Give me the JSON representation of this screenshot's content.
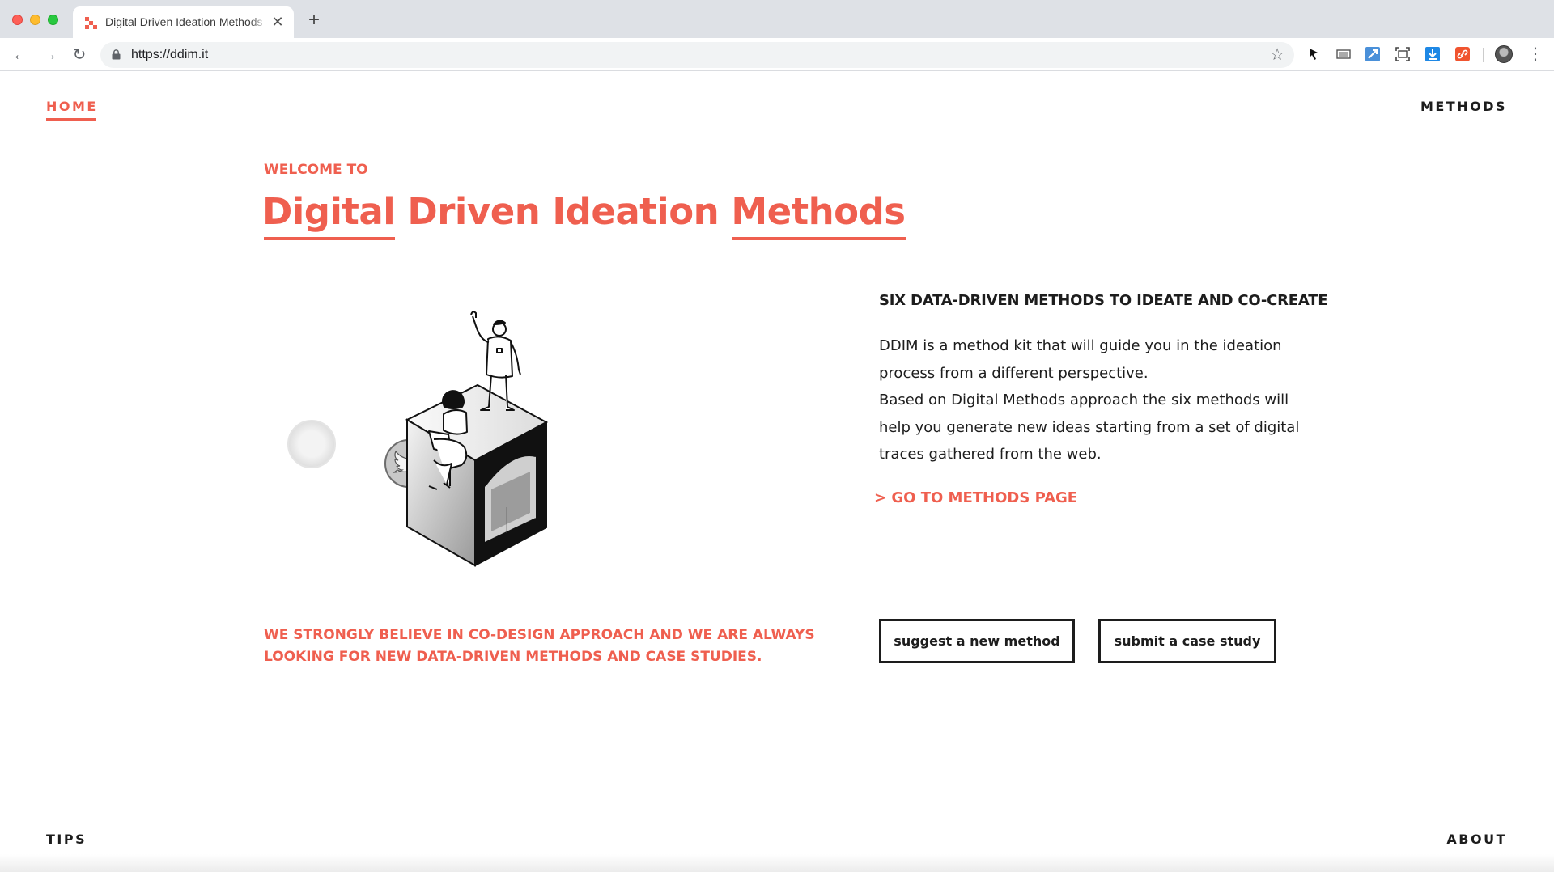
{
  "browser": {
    "tab_title": "Digital Driven Ideation Methods",
    "tab_close_icon": "close-icon",
    "new_tab_glyph": "+",
    "url": "https://ddim.it",
    "back_glyph": "←",
    "forward_glyph": "→",
    "reload_glyph": "↻",
    "star_glyph": "☆",
    "menu_glyph": "⋮",
    "close_glyph": "✕"
  },
  "nav": {
    "home": "HOME",
    "methods": "METHODS",
    "tips": "TIPS",
    "about": "ABOUT"
  },
  "hero": {
    "welcome": "WELCOME TO",
    "title_part1": "Digital",
    "title_part2": " Driven Ideation ",
    "title_part3": "Methods"
  },
  "intro": {
    "subhead": "SIX DATA-DRIVEN METHODS TO IDEATE AND CO-CREATE",
    "line1": "DDIM is a method kit that will guide you in the ideation process from a different perspective.",
    "line2": "Based on Digital Methods approach the six methods will help you generate new ideas starting from a set of digital traces gathered from the web.",
    "goto_link": "> GO TO METHODS PAGE"
  },
  "cta": {
    "statement": "WE STRONGLY BELIEVE IN CO-DESIGN APPROACH AND WE ARE ALWAYS LOOKING FOR NEW DATA-DRIVEN METHODS AND CASE STUDIES.",
    "suggest_button": "suggest a new method",
    "submit_button": "submit a case study"
  },
  "colors": {
    "accent": "#ef5f4f",
    "text": "#1d1d1d"
  }
}
